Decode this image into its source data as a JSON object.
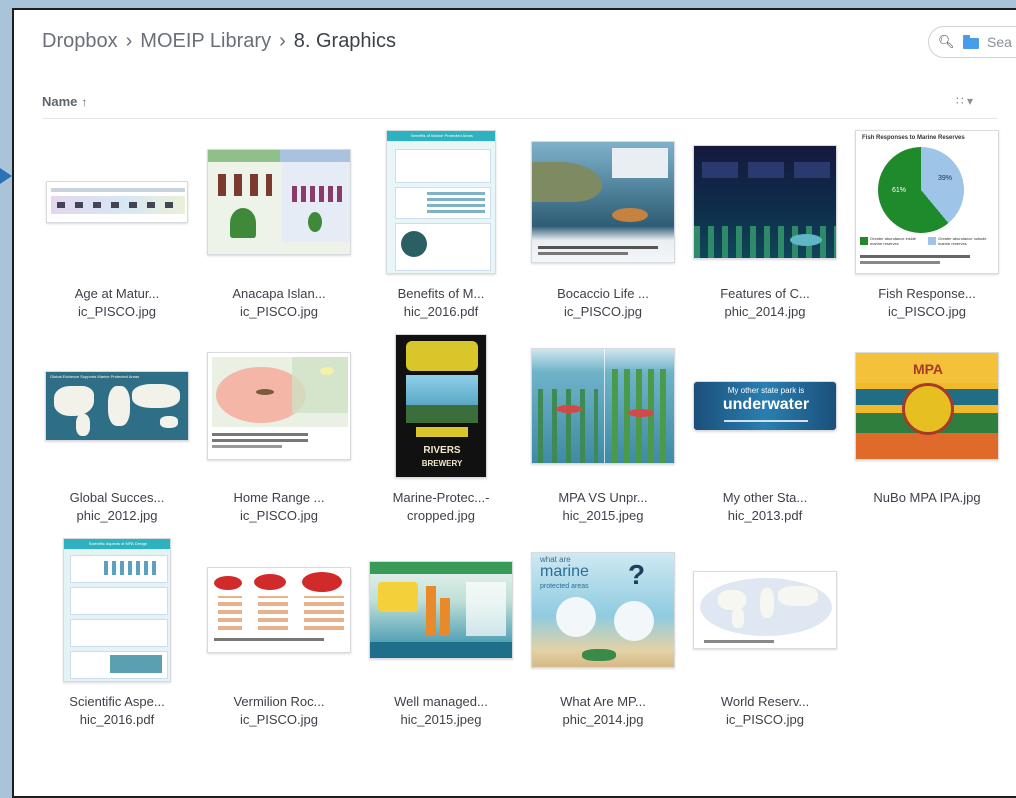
{
  "breadcrumb": {
    "root": "Dropbox",
    "parent": "MOEIP Library",
    "current": "8. Graphics",
    "separator": "›"
  },
  "search": {
    "placeholder": "Sea",
    "icon": "search-icon",
    "folder_icon": "folder-icon"
  },
  "list_header": {
    "name_label": "Name",
    "sort_icon": "arrow-up-icon",
    "view_icon": "grid-view-icon"
  },
  "files": [
    {
      "line1": "Age at Matur...",
      "line2": "ic_PISCO.jpg"
    },
    {
      "line1": "Anacapa Islan...",
      "line2": "ic_PISCO.jpg"
    },
    {
      "line1": "Benefits of M...",
      "line2": "hic_2016.pdf"
    },
    {
      "line1": "Bocaccio Life ...",
      "line2": "ic_PISCO.jpg"
    },
    {
      "line1": "Features of C...",
      "line2": "phic_2014.jpg"
    },
    {
      "line1": "Fish Response...",
      "line2": "ic_PISCO.jpg"
    },
    {
      "line1": "Global Succes...",
      "line2": "phic_2012.jpg"
    },
    {
      "line1": "Home Range ...",
      "line2": "ic_PISCO.jpg"
    },
    {
      "line1": "Marine-Protec...-",
      "line2": "cropped.jpg"
    },
    {
      "line1": "MPA VS Unpr...",
      "line2": "hic_2015.jpeg"
    },
    {
      "line1": "My other Sta...",
      "line2": "hic_2013.pdf"
    },
    {
      "line1": "NuBo MPA IPA.jpg",
      "line2": ""
    },
    {
      "line1": "Scientific Aspe...",
      "line2": "hic_2016.pdf"
    },
    {
      "line1": "Vermilion Roc...",
      "line2": "ic_PISCO.jpg"
    },
    {
      "line1": "Well managed...",
      "line2": "hic_2015.jpeg"
    },
    {
      "line1": "What Are MP...",
      "line2": "phic_2014.jpg"
    },
    {
      "line1": "World Reserv...",
      "line2": "ic_PISCO.jpg"
    }
  ],
  "thumb_text": {
    "benefits_title": "Benefits of Marine Protected Areas",
    "fish_title": "Fish Responses to Marine Reserves",
    "fish_pct_a": "61%",
    "fish_pct_b": "39%",
    "fish_leg_a": "Greater abundance inside marine reserves",
    "fish_leg_b": "Greater abundance outside marine reserves",
    "global_title": "Global Evidence Supports Marine Protected Areas",
    "rivers": "RIVERS",
    "brewery": "BREWERY",
    "other_top": "My other state park is",
    "other_big": "underwater",
    "nubo": "MPA",
    "sci_title": "Scientific Aspects of MPA Design",
    "what_small": "what are",
    "what_big": "marine",
    "what_small2": "protected areas"
  },
  "colors": {
    "accent": "#4a9ce8",
    "arrow": "#2a73b8",
    "frame": "#1e1e1e"
  }
}
